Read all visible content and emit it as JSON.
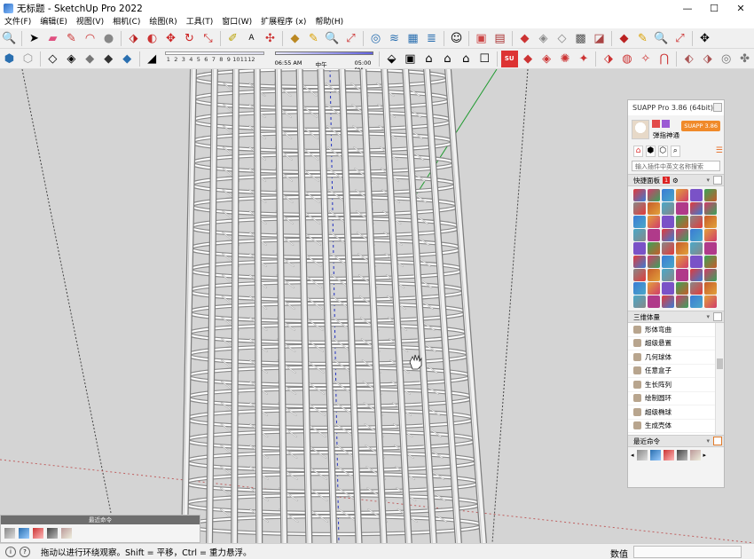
{
  "window": {
    "title": "无标题 - SketchUp Pro 2022",
    "minimize": "—",
    "maximize": "☐",
    "close": "✕"
  },
  "menu": [
    "文件(F)",
    "编辑(E)",
    "视图(V)",
    "相机(C)",
    "绘图(R)",
    "工具(T)",
    "窗口(W)",
    "扩展程序 (x)",
    "帮助(H)"
  ],
  "shadow": {
    "months": [
      "1",
      "2",
      "3",
      "4",
      "5",
      "6",
      "7",
      "8",
      "9",
      "10",
      "11",
      "12"
    ],
    "time_start": "06:55 AM",
    "time_mid": "中午",
    "time_end": "05:00 PM"
  },
  "suapp": {
    "title": "SUAPP Pro 3.86 (64bit)",
    "username": "弹指神通",
    "version_button": "SUAPP 3.86",
    "search_placeholder": "输入插件中英文名称搜索",
    "quick_panel": {
      "label": "快捷面板",
      "badge": "1"
    },
    "section_3d": "三维体量",
    "items": [
      "形体弯曲",
      "超级悬置",
      "几何球体",
      "任意盒子",
      "生长阵列",
      "绘制圆环",
      "超级椭球",
      "生成壳体"
    ],
    "section_recent": "最近命令"
  },
  "tray": {
    "title": "最近命令"
  },
  "status": {
    "message": "拖动以进行环绕观察。Shift = 平移，Ctrl = 重力悬浮。",
    "value_label": "数值",
    "value": ""
  },
  "colors": {
    "axis_red": "#c01f1f",
    "axis_green": "#1f9a2f",
    "axis_blue": "#2030c0",
    "viewport_bg": "#d4d4d4",
    "accent_orange": "#f08a2a"
  }
}
